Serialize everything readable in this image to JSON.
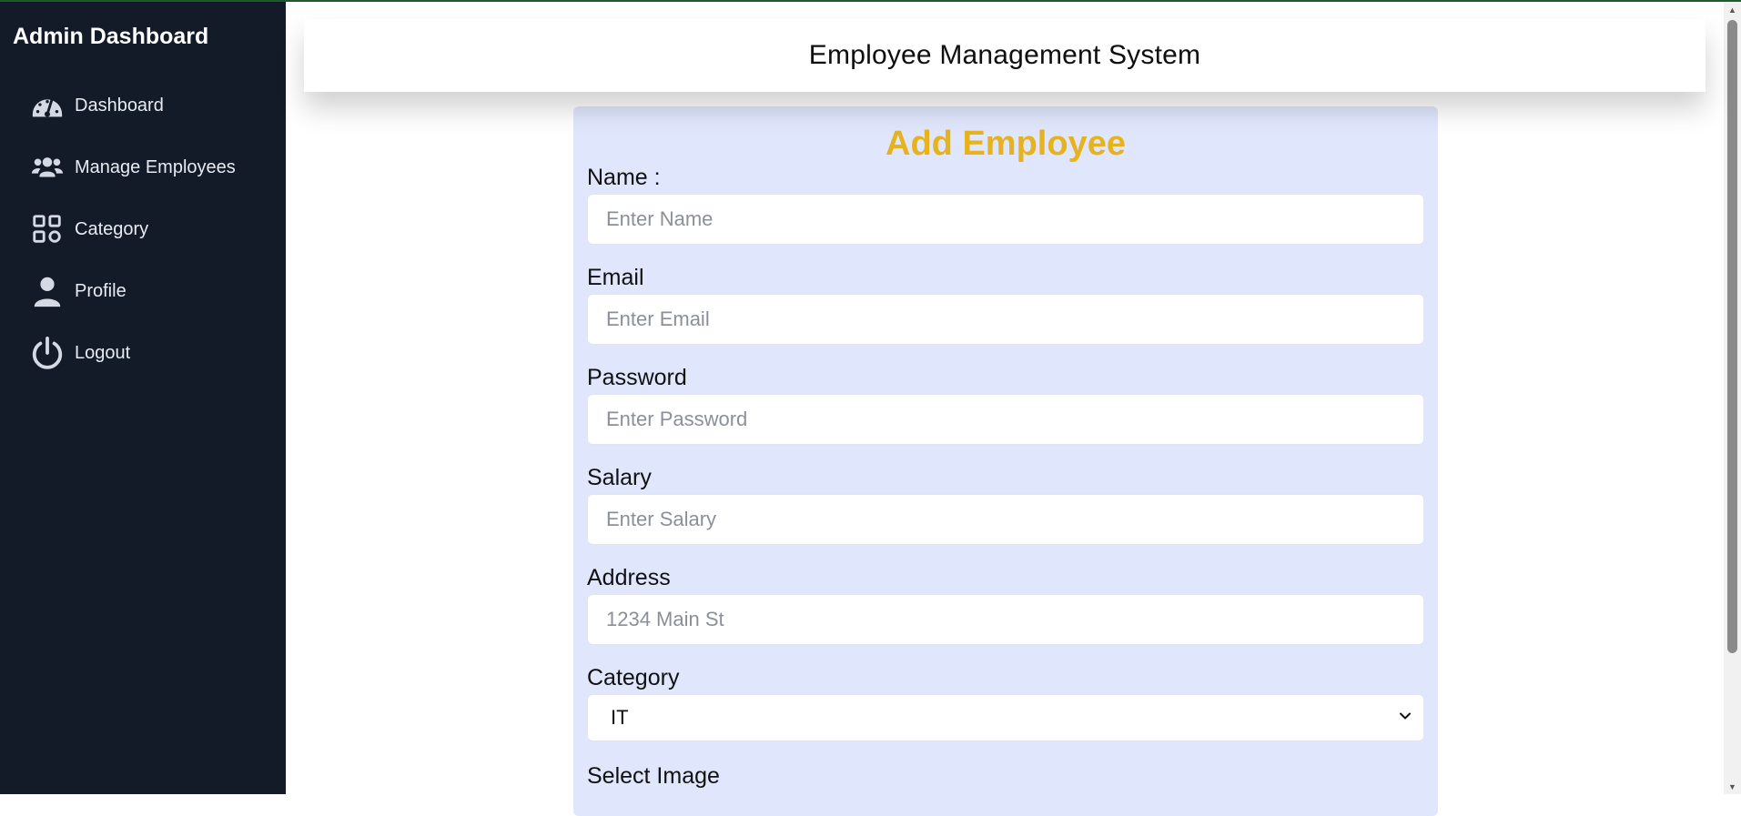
{
  "sidebar": {
    "title": "Admin Dashboard",
    "items": [
      {
        "label": "Dashboard",
        "icon": "gauge-icon"
      },
      {
        "label": "Manage Employees",
        "icon": "users-icon"
      },
      {
        "label": "Category",
        "icon": "grid-icon"
      },
      {
        "label": "Profile",
        "icon": "user-icon"
      },
      {
        "label": "Logout",
        "icon": "power-icon"
      }
    ]
  },
  "header": {
    "title": "Employee Management System"
  },
  "form": {
    "title": "Add Employee",
    "name_label": "Name :",
    "name_placeholder": "Enter Name",
    "email_label": "Email",
    "email_placeholder": "Enter Email",
    "password_label": "Password",
    "password_placeholder": "Enter Password",
    "salary_label": "Salary",
    "salary_placeholder": "Enter Salary",
    "address_label": "Address",
    "address_placeholder": "1234 Main St",
    "category_label": "Category",
    "category_value": "IT",
    "image_label": "Select Image"
  },
  "colors": {
    "sidebar_bg": "#131a28",
    "card_bg": "#e0e6fc",
    "accent_title": "#e6b21d"
  }
}
